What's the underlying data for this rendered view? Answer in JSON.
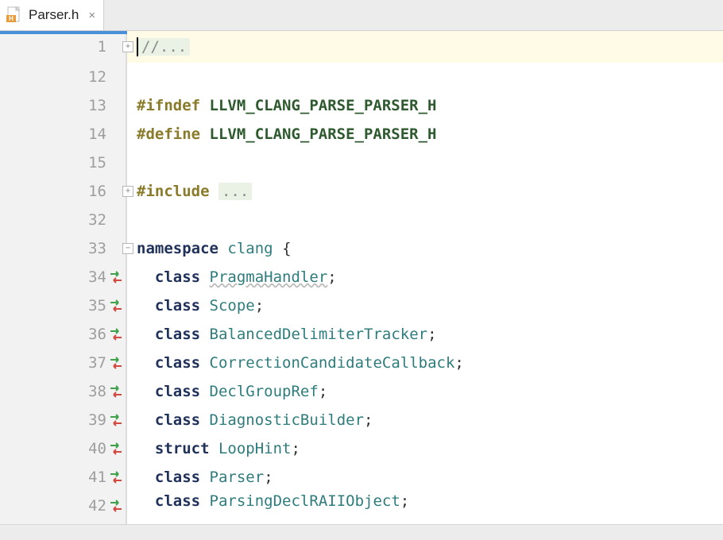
{
  "tab": {
    "filename": "Parser.h",
    "close_glyph": "×"
  },
  "gutter": {
    "lines": [
      "1",
      "12",
      "13",
      "14",
      "15",
      "16",
      "32",
      "33",
      "34",
      "35",
      "36",
      "37",
      "38",
      "39",
      "40",
      "41",
      "42"
    ],
    "changed_rows": [
      8,
      9,
      10,
      11,
      12,
      13,
      14,
      15,
      16
    ],
    "fold_plus_rows": [
      0,
      5
    ],
    "fold_minus_rows": [
      7
    ]
  },
  "code": {
    "rows": [
      {
        "highlight": true,
        "segments": [
          {
            "cls": "cursor",
            "text": ""
          },
          {
            "cls": "comment folded-box",
            "text": "//..."
          }
        ]
      },
      {
        "segments": []
      },
      {
        "segments": [
          {
            "cls": "pp",
            "text": "#ifndef "
          },
          {
            "cls": "macro",
            "text": "LLVM_CLANG_PARSE_PARSER_H"
          }
        ]
      },
      {
        "segments": [
          {
            "cls": "pp",
            "text": "#define "
          },
          {
            "cls": "macro",
            "text": "LLVM_CLANG_PARSE_PARSER_H"
          }
        ]
      },
      {
        "segments": []
      },
      {
        "segments": [
          {
            "cls": "pp",
            "text": "#include "
          },
          {
            "cls": "folded-box comment",
            "text": "..."
          }
        ]
      },
      {
        "segments": []
      },
      {
        "segments": [
          {
            "cls": "kw",
            "text": "namespace"
          },
          {
            "cls": "",
            "text": " "
          },
          {
            "cls": "ident",
            "text": "clang"
          },
          {
            "cls": "",
            "text": " "
          },
          {
            "cls": "punct",
            "text": "{"
          }
        ]
      },
      {
        "indent": "  ",
        "segments": [
          {
            "cls": "kw",
            "text": "class"
          },
          {
            "cls": "",
            "text": " "
          },
          {
            "cls": "ident underline-wavy",
            "text": "PragmaHandler"
          },
          {
            "cls": "punct",
            "text": ";"
          }
        ]
      },
      {
        "indent": "  ",
        "segments": [
          {
            "cls": "kw",
            "text": "class"
          },
          {
            "cls": "",
            "text": " "
          },
          {
            "cls": "ident",
            "text": "Scope"
          },
          {
            "cls": "punct",
            "text": ";"
          }
        ]
      },
      {
        "indent": "  ",
        "segments": [
          {
            "cls": "kw",
            "text": "class"
          },
          {
            "cls": "",
            "text": " "
          },
          {
            "cls": "ident",
            "text": "BalancedDelimiterTracker"
          },
          {
            "cls": "punct",
            "text": ";"
          }
        ]
      },
      {
        "indent": "  ",
        "segments": [
          {
            "cls": "kw",
            "text": "class"
          },
          {
            "cls": "",
            "text": " "
          },
          {
            "cls": "ident",
            "text": "CorrectionCandidateCallback"
          },
          {
            "cls": "punct",
            "text": ";"
          }
        ]
      },
      {
        "indent": "  ",
        "segments": [
          {
            "cls": "kw",
            "text": "class"
          },
          {
            "cls": "",
            "text": " "
          },
          {
            "cls": "ident",
            "text": "DeclGroupRef"
          },
          {
            "cls": "punct",
            "text": ";"
          }
        ]
      },
      {
        "indent": "  ",
        "segments": [
          {
            "cls": "kw",
            "text": "class"
          },
          {
            "cls": "",
            "text": " "
          },
          {
            "cls": "ident",
            "text": "DiagnosticBuilder"
          },
          {
            "cls": "punct",
            "text": ";"
          }
        ]
      },
      {
        "indent": "  ",
        "segments": [
          {
            "cls": "kw",
            "text": "struct"
          },
          {
            "cls": "",
            "text": " "
          },
          {
            "cls": "ident",
            "text": "LoopHint"
          },
          {
            "cls": "punct",
            "text": ";"
          }
        ]
      },
      {
        "indent": "  ",
        "segments": [
          {
            "cls": "kw",
            "text": "class"
          },
          {
            "cls": "",
            "text": " "
          },
          {
            "cls": "ident",
            "text": "Parser"
          },
          {
            "cls": "punct",
            "text": ";"
          }
        ]
      },
      {
        "indent": "  ",
        "segments": [
          {
            "cls": "kw",
            "text": "class"
          },
          {
            "cls": "",
            "text": " "
          },
          {
            "cls": "ident",
            "text": "ParsingDeclRAIIObject"
          },
          {
            "cls": "punct",
            "text": ";"
          }
        ],
        "cut": true
      }
    ]
  }
}
